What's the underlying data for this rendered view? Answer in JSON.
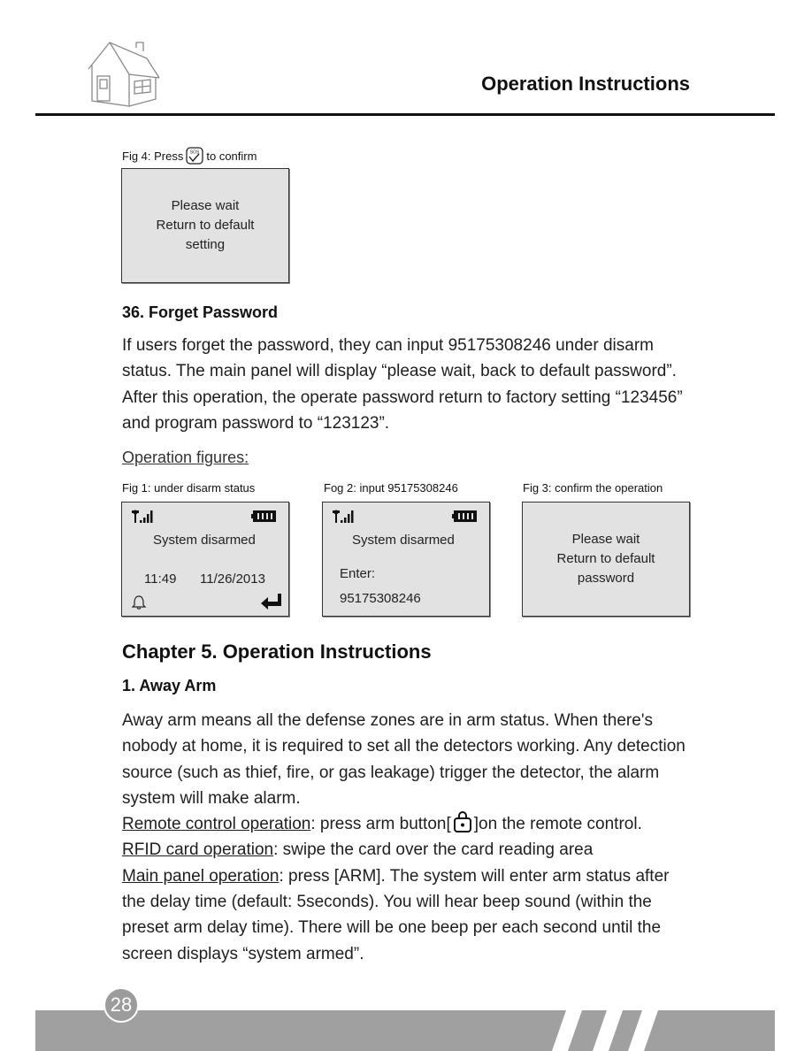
{
  "header": {
    "title": "Operation Instructions",
    "logo_icon": "house-icon"
  },
  "fig4": {
    "caption_prefix": "Fig 4: Press",
    "caption_icon": "sos-confirm-icon",
    "caption_suffix": "to confirm",
    "screen_lines": [
      "Please  wait",
      "Return  to  default",
      "setting"
    ]
  },
  "section36": {
    "title": "36. Forget Password",
    "body": "If users forget the password, they can input 95175308246 under disarm status. The main panel will display “please wait, back to default password”. After this operation, the operate password return to factory setting “123456” and program password to “123123”.",
    "figures_heading": "Operation figures:"
  },
  "figures": [
    {
      "caption": "Fig 1: under disarm status",
      "status": "System  disarmed",
      "time": "11:49",
      "date": "11/26/2013",
      "icons": [
        "signal-icon",
        "battery-icon",
        "bell-icon",
        "enter-icon"
      ]
    },
    {
      "caption": "Fog 2: input 95175308246",
      "status": "System  disarmed",
      "enter_label": "Enter:",
      "entered_value": "95175308246",
      "icons": [
        "signal-icon",
        "battery-icon"
      ]
    },
    {
      "caption": "Fig 3: confirm the operation",
      "screen_lines": [
        "Please  wait",
        "Return  to  default",
        "password"
      ]
    }
  ],
  "chapter5": {
    "title": "Chapter 5.  Operation Instructions",
    "section1_title": "1. Away Arm",
    "intro": "Away arm means all the defense zones are in arm status. When there's nobody at home, it is required to set all the detectors working. Any detection source (such as thief, fire, or gas leakage) trigger the detector, the alarm system will make alarm.",
    "remote_label": "Remote control operation",
    "remote_text_a": ": press arm button[",
    "remote_icon": "lock-arm-icon",
    "remote_text_b": "]on the remote control.",
    "rfid_label": "RFID card operation",
    "rfid_text": ": swipe the card over the card reading area",
    "panel_label": "Main panel operation",
    "panel_text": ": press [ARM]. The system will enter arm status after the delay time (default: 5seconds). You will hear beep sound (within the preset arm delay time). There will be one beep per each second until the screen displays “system armed”."
  },
  "footer": {
    "page_number": "28",
    "colors": {
      "band": "#a0a0a0",
      "badge": "#9c9c9c"
    }
  }
}
